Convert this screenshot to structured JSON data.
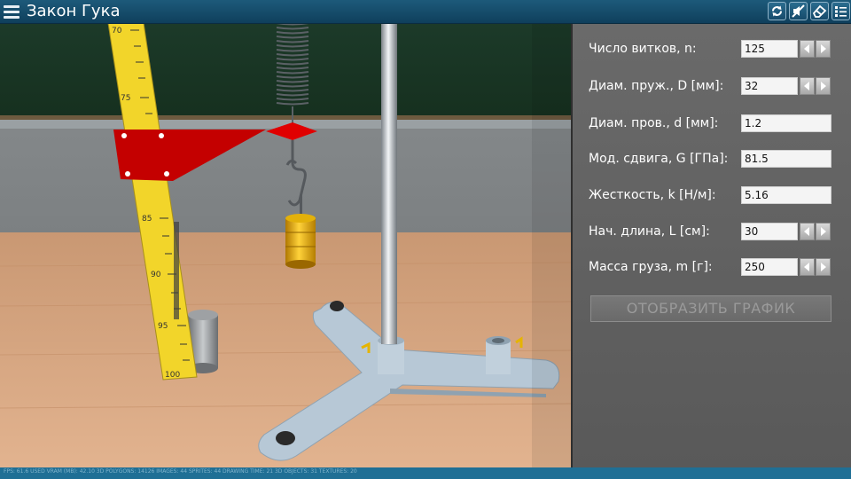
{
  "app": {
    "title": "Закон Гука"
  },
  "icons": {
    "menu": "hamburger-menu-icon",
    "toolbar": [
      "reset-icon",
      "mute-icon",
      "eraser-icon",
      "list-icon"
    ]
  },
  "colors": {
    "topbar": "#164b6b",
    "panel": "#626262",
    "ruler": "#f2d52a",
    "pointer": "#cc0000",
    "weight": "#e8a800",
    "board": "#1f3b2a",
    "table": "#d9a47a",
    "stand": "#b7c8d6"
  },
  "ruler": {
    "ticks": [
      "70",
      "75",
      "85",
      "90",
      "95",
      "100"
    ]
  },
  "params": [
    {
      "label": "Число витков, n:",
      "value": "125",
      "arrows": true
    },
    {
      "label": "Диам. пруж., D [мм]:",
      "value": "32",
      "arrows": true
    },
    {
      "label": "Диам. пров., d [мм]:",
      "value": "1.2",
      "arrows": false
    },
    {
      "label": "Мод. сдвига, G [ГПа]:",
      "value": "81.5",
      "arrows": false
    },
    {
      "label": "Жесткость, k [Н/м]:",
      "value": "5.16",
      "arrows": false
    },
    {
      "label": "Нач. длина, L [см]:",
      "value": "30",
      "arrows": true
    },
    {
      "label": "Масса груза, m [г]:",
      "value": "250",
      "arrows": true
    }
  ],
  "actions": {
    "plot_button": "ОТОБРАЗИТЬ ГРАФИК"
  },
  "status": {
    "text": "FPS: 61.6   USED VRAM (MB): 42.10   3D POLYGONS: 14126   IMAGES: 44   SPRITES: 44   DRAWING TIME: 21   3D OBJECTS: 31   TEXTURES: 20"
  }
}
